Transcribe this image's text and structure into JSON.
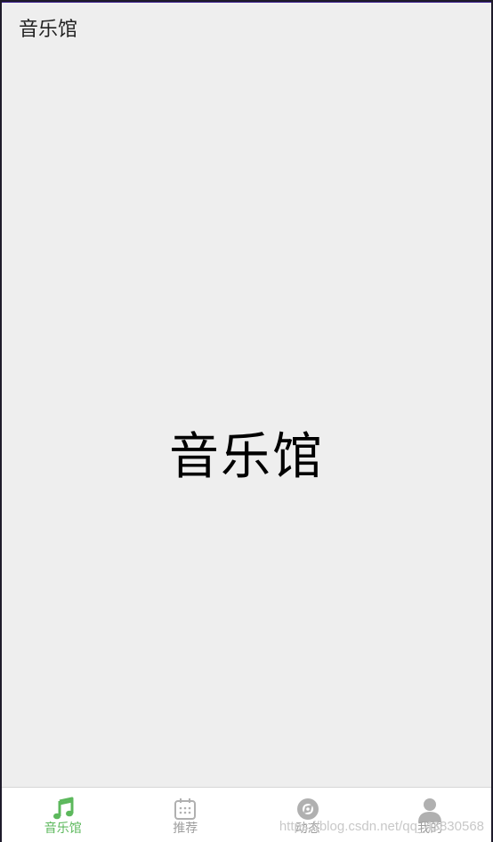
{
  "app_bar": {
    "title": "音乐馆"
  },
  "content": {
    "title": "音乐馆"
  },
  "bottom_nav": {
    "active_index": 0,
    "active_color": "#5cb85c",
    "inactive_color": "#b0b0b0",
    "items": [
      {
        "label": "音乐馆",
        "icon": "music-note-icon"
      },
      {
        "label": "推荐",
        "icon": "calendar-icon"
      },
      {
        "label": "动态",
        "icon": "disc-icon"
      },
      {
        "label": "我的",
        "icon": "person-icon"
      }
    ]
  },
  "watermark": {
    "text": "https://blog.csdn.net/qq_43830568"
  }
}
